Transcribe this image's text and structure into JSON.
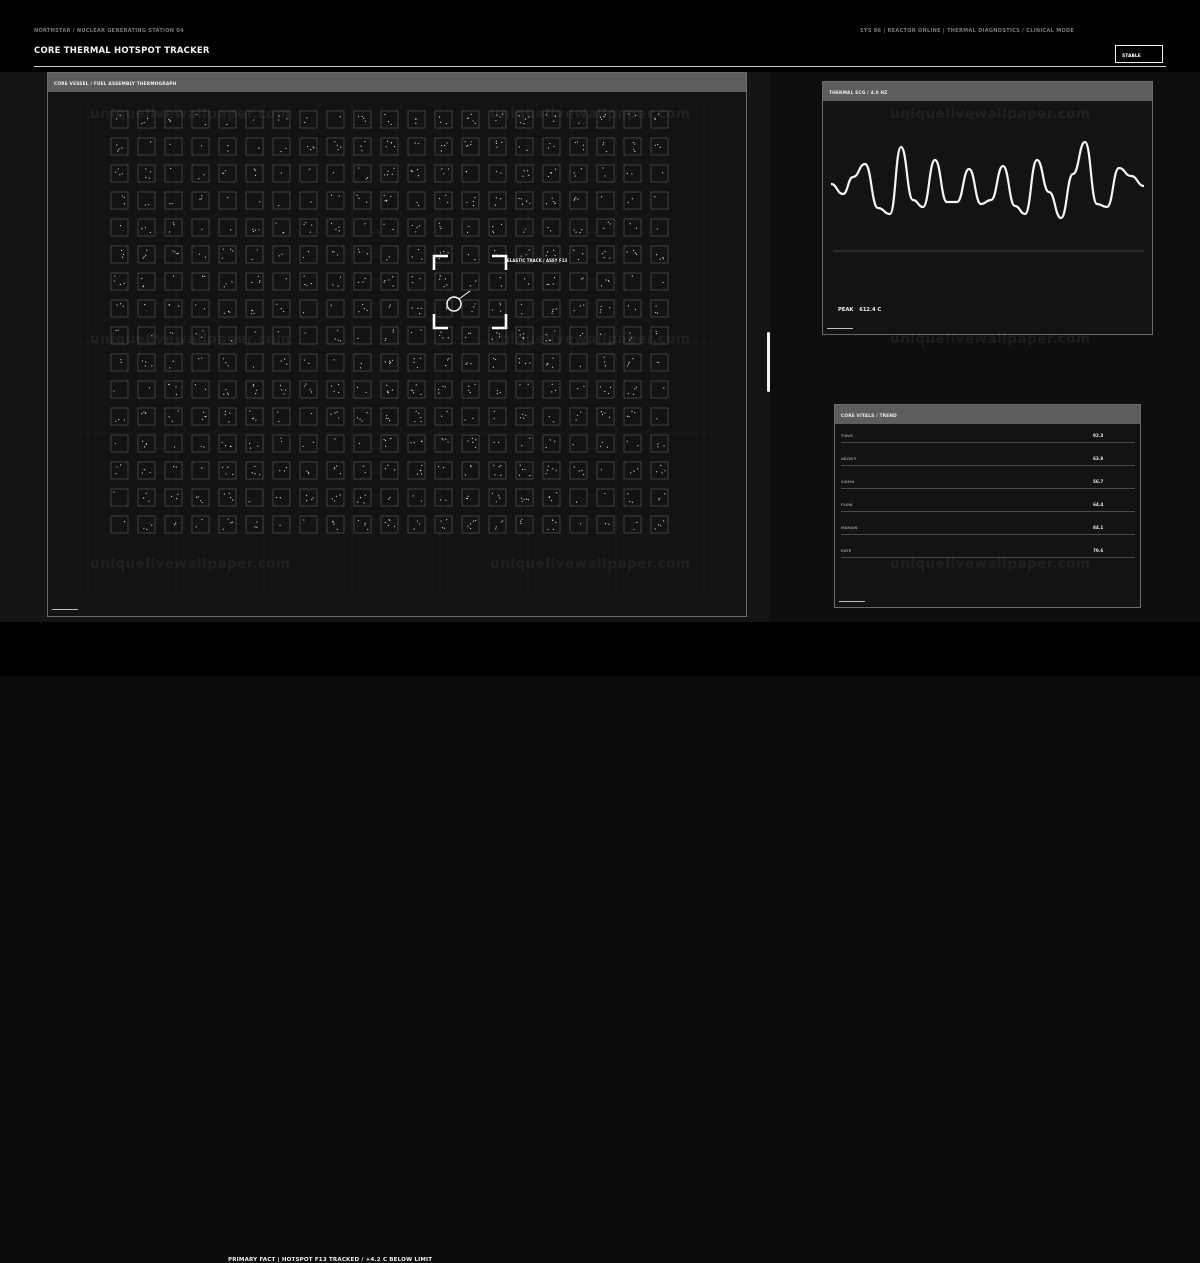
{
  "header": {
    "breadcrumb": "NORTHSTAR / NUCLEAR GENERATING STATION 04",
    "system_info": "SYS 86  |  REACTOR ONLINE  |  THERMAL DIAGNOSTICS / CLINICAL MODE",
    "title": "CORE THERMAL HOTSPOT TRACKER",
    "status_button": "STABLE"
  },
  "thermograph": {
    "title": "CORE VESSEL / FUEL ASSEMBLY THERMOGRAPH",
    "tracker_label": "ELASTIC TRACK / ASSY F13",
    "rows": 16,
    "cols": 21
  },
  "ecg": {
    "title": "THERMAL ECG / 4.0 HZ",
    "peak_label": "PEAK",
    "peak_value": "612.4 C"
  },
  "vitals": {
    "title": "CORE VITALS / TREND",
    "rows": [
      {
        "label": "T-AVG",
        "value": "92.3"
      },
      {
        "label": "DELTA-T",
        "value": "63.8"
      },
      {
        "label": "SIGMA",
        "value": "56.7"
      },
      {
        "label": "FLOW",
        "value": "64.4"
      },
      {
        "label": "MARGIN",
        "value": "84.1"
      },
      {
        "label": "RATE",
        "value": "79.6"
      }
    ]
  },
  "footer": {
    "fact": "PRIMARY FACT  |  HOTSPOT F13 TRACKED / +4.2 C BELOW LIMIT"
  },
  "watermark": "uniquelivewallpaper.com",
  "colors": {
    "background": "#0b0b0b",
    "panel_header": "#5d5d5d",
    "accent": "#ffffff"
  }
}
